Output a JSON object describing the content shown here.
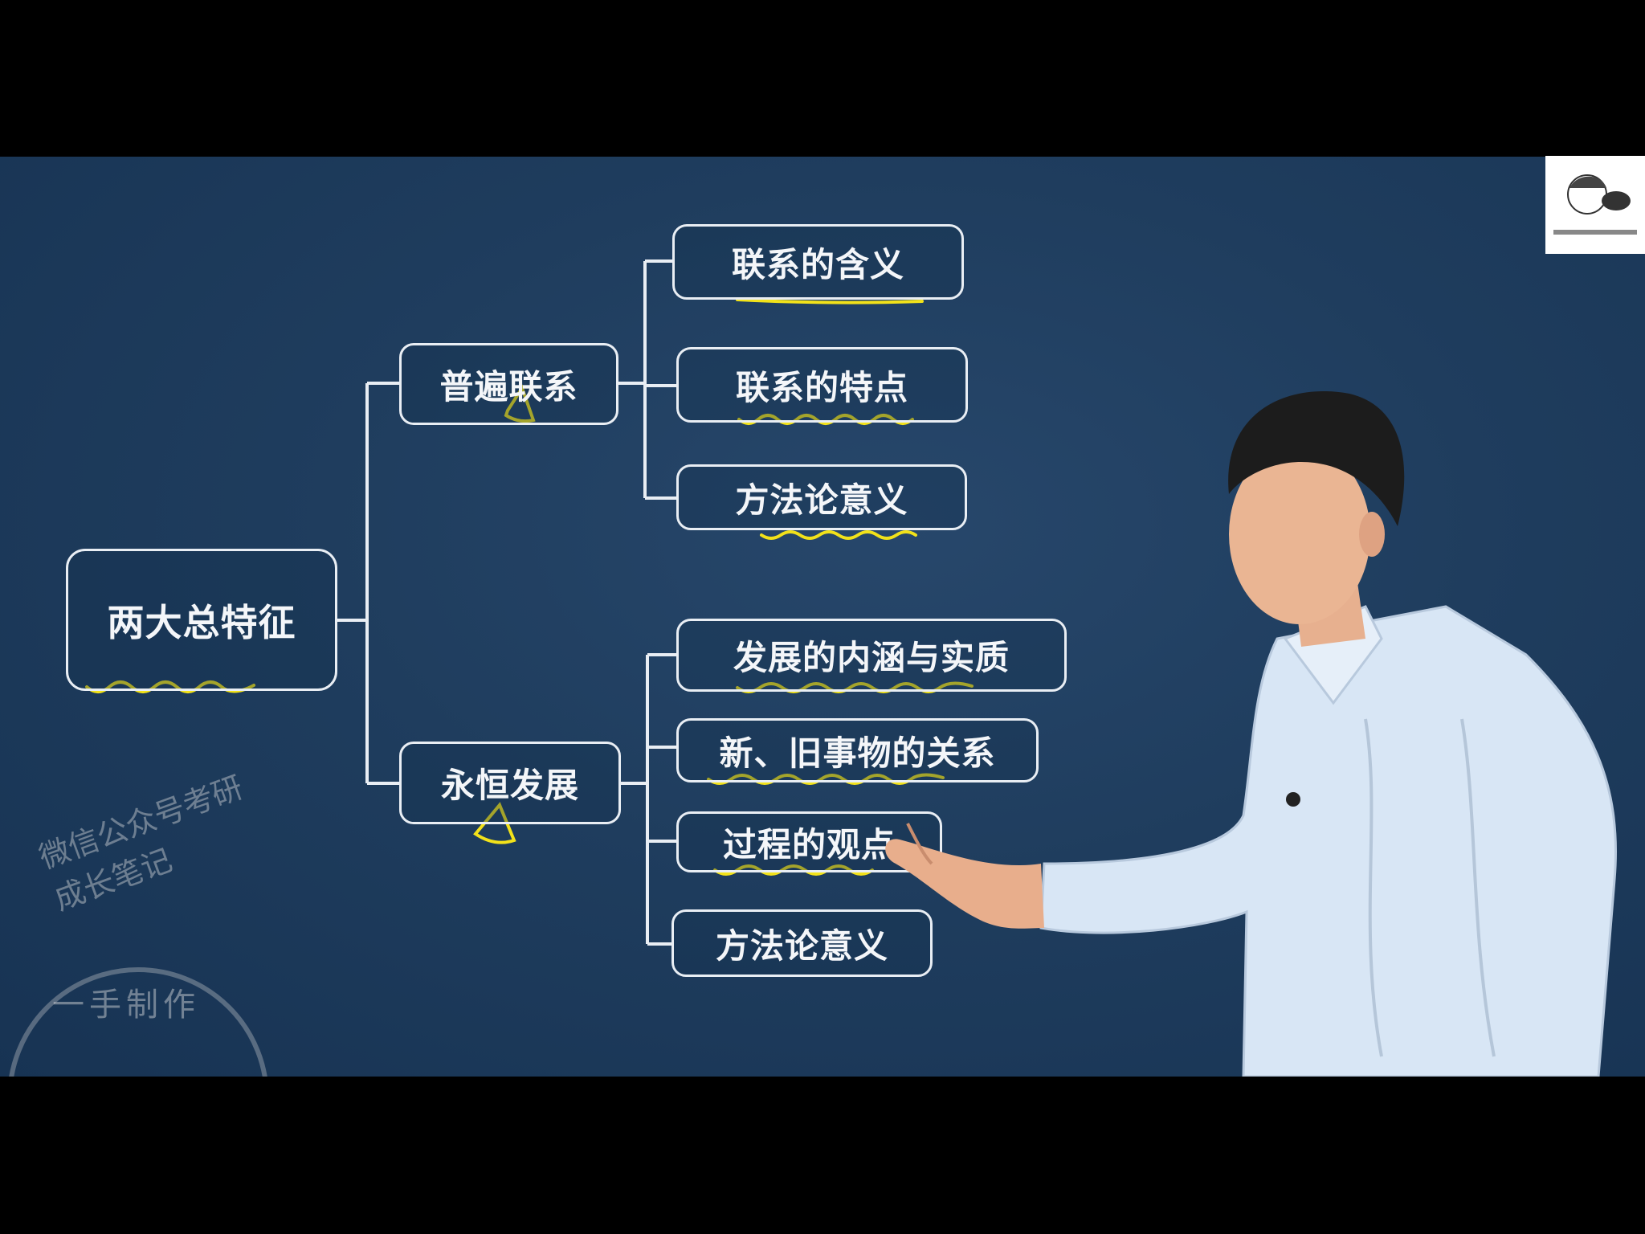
{
  "diagram": {
    "root": "两大总特征",
    "branches": [
      {
        "label": "普遍联系",
        "children": [
          "联系的含义",
          "联系的特点",
          "方法论意义"
        ]
      },
      {
        "label": "永恒发展",
        "children": [
          "发展的内涵与实质",
          "新、旧事物的关系",
          "过程的观点",
          "方法论意义"
        ]
      }
    ]
  },
  "watermark": {
    "ring_text": "微信公众号考研成长笔记",
    "center_text": "一手制作"
  },
  "colors": {
    "board": "#1f3d5e",
    "line": "#e9eef4",
    "highlight": "#f2e21a",
    "text": "#f4f6f9"
  }
}
